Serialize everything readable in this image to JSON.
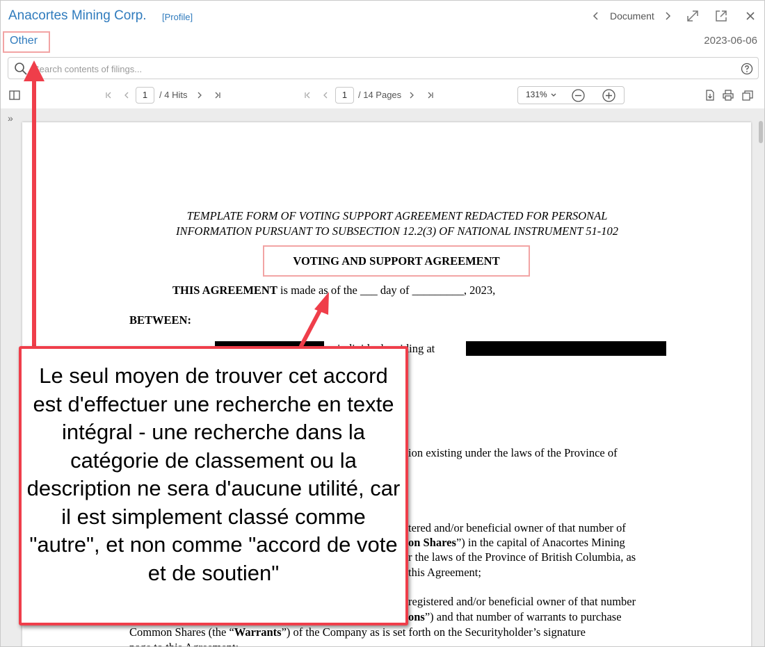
{
  "header": {
    "company": "Anacortes Mining Corp.",
    "profile_link": "[Profile]",
    "nav_label": "Document",
    "category": "Other",
    "date": "2023-06-06"
  },
  "search": {
    "placeholder": "Search contents of filings..."
  },
  "toolbar": {
    "hits_current": "1",
    "hits_total": "/ 4 Hits",
    "pages_current": "1",
    "pages_total": "/ 14 Pages",
    "zoom_level": "131%"
  },
  "icons": [
    "sidebar-toggle-icon",
    "chevron-left-icon",
    "chevron-right-icon",
    "expand-icon",
    "popout-icon",
    "close-icon",
    "search-icon",
    "help-icon",
    "first-page-icon",
    "prev-icon",
    "next-icon",
    "last-page-icon",
    "zoom-out-icon",
    "zoom-in-icon",
    "download-icon",
    "print-icon",
    "copy-icon",
    "expand-sidebar-icon"
  ],
  "colors": {
    "link": "#2f7bbd",
    "highlight_border": "#f2a4a4",
    "callout_red": "#ef3e4a"
  },
  "document": {
    "heading_line1": "TEMPLATE FORM OF VOTING SUPPORT AGREEMENT REDACTED FOR PERSONAL",
    "heading_line2": "INFORMATION PURSUANT TO SUBSECTION 12.2(3) OF NATIONAL INSTRUMENT 51-102",
    "title": "VOTING AND SUPPORT AGREEMENT",
    "intro_bold": "THIS AGREEMENT",
    "intro_rest": " is made as of the ___ day of _________, 2023,",
    "between": "BETWEEN:",
    "party_line": "individual residing at",
    "province_line": "ion existing under the laws of the Province of",
    "p1_line1": "tered and/or beneficial owner of that number of",
    "p1_line2_bold": "on Shares",
    "p1_line2_rest": "”) in the capital of Anacortes Mining",
    "p1_line3": "r the laws of the Province of British Columbia, as",
    "p1_line4": "this Agreement;",
    "p2_line1": "registered and/or beneficial owner of that number",
    "p2_line2_bold": "ons",
    "p2_line2_rest": "”) and that number of warrants to purchase",
    "p2_line3_a": "Common Shares (the “",
    "p2_line3_bold": "Warrants",
    "p2_line3_b": "”) of the Company as is set forth on the Securityholder’s signature",
    "p2_line4": "page to this Agreement;"
  },
  "annotation": {
    "text": "Le seul moyen de trouver cet accord est d'effectuer une recherche en texte intégral - une recherche dans la catégorie de classement ou la description ne sera d'aucune utilité, car il est simplement classé comme \"autre\", et non comme \"accord de vote et de soutien\""
  }
}
